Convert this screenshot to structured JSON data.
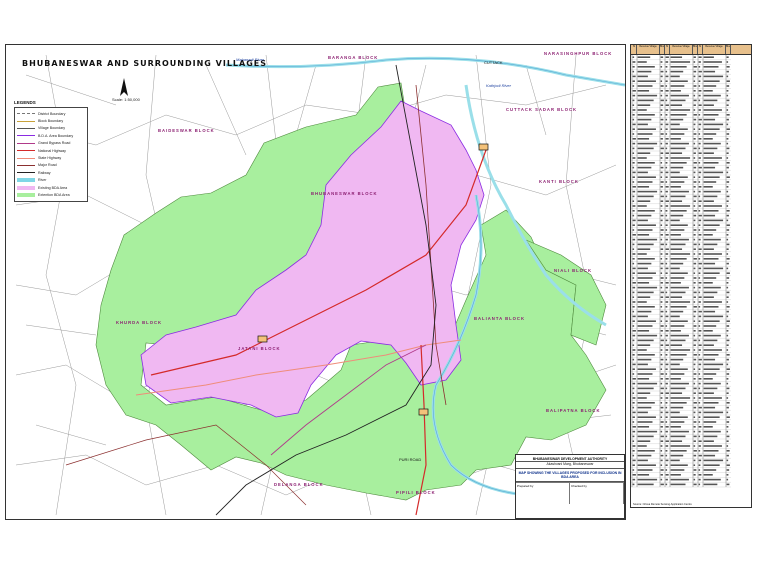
{
  "map": {
    "title": "BHUBANESWAR AND SURROUNDING VILLAGES",
    "scale": "Scale: 1:50,000",
    "legend": {
      "title": "LEGENDS",
      "items": [
        {
          "label": "District Boundary",
          "color": "#777777",
          "style": "dash"
        },
        {
          "label": "Block Boundary",
          "color": "#c9a23a",
          "style": "line"
        },
        {
          "label": "Village Boundary",
          "color": "#555555",
          "style": "line"
        },
        {
          "label": "B.D.A. Area Boundary",
          "color": "#8a2be2",
          "style": "line"
        },
        {
          "label": "Grand Bypass Road",
          "color": "#b03a8a",
          "style": "line"
        },
        {
          "label": "National Highway",
          "color": "#d42a2a",
          "style": "line"
        },
        {
          "label": "State Highway",
          "color": "#ef8c7a",
          "style": "line"
        },
        {
          "label": "Major Road",
          "color": "#8b2f2f",
          "style": "line"
        },
        {
          "label": "Railway",
          "color": "#222222",
          "style": "line"
        },
        {
          "label": "River",
          "color": "#7fd7e6",
          "style": "fill"
        },
        {
          "label": "Existing BDA Area",
          "color": "#f0b8f2",
          "style": "fill"
        },
        {
          "label": "Extention BDA Area",
          "color": "#a8ef9e",
          "style": "fill"
        }
      ]
    },
    "regions": [
      "BHUBANESWAR BLOCK",
      "JATANI BLOCK",
      "KHURDA BLOCK",
      "BALIANTA BLOCK",
      "BALIPATNA BLOCK",
      "PIPILI BLOCK",
      "DELANGA BLOCK",
      "KANTI BLOCK",
      "NIALI BLOCK",
      "CUTTACK SADAR BLOCK",
      "BARANGA BLOCK",
      "BAIDESWAR BLOCK",
      "NARASINGHPUR BLOCK"
    ],
    "rivers": [
      "Mahanadi River",
      "Kathjodi River"
    ],
    "towns": [
      "PURI ROAD",
      "CUTTACK"
    ],
    "colors": {
      "existing_bda": "#f0b8f2",
      "extension_bda": "#a8ef9e",
      "river": "#9adfe9",
      "road_red": "#d42a2a"
    }
  },
  "title_block": {
    "authority": "BHUBANESWAR DEVELOPMENT AUTHORITY",
    "address": "Akashvani Marg, Bhubaneswar",
    "map_title": "MAP SHOWING THE VILLAGES PROPOSED FOR INCLUSION IN BDA AREA",
    "prepared_label": "Prepared by",
    "checked_label": "Checked by"
  },
  "village_list": {
    "headers": [
      "Sl",
      "Revenue Village",
      "Block"
    ],
    "footer": "Source: Orissa Remote Sensing Application Centre"
  }
}
